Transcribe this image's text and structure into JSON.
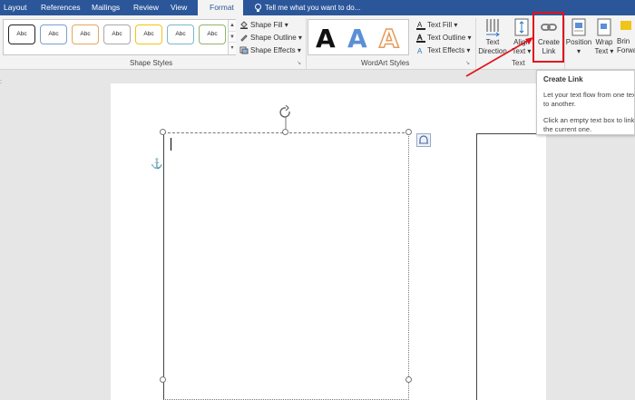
{
  "tabs": [
    {
      "label": "Layout",
      "active": false
    },
    {
      "label": "References",
      "active": false
    },
    {
      "label": "Mailings",
      "active": false
    },
    {
      "label": "Review",
      "active": false
    },
    {
      "label": "View",
      "active": false
    },
    {
      "label": "Format",
      "active": true
    }
  ],
  "tell_me": "Tell me what you want to do...",
  "shape_styles": {
    "label": "Shape Styles",
    "presets": [
      "Abc",
      "Abc",
      "Abc",
      "Abc",
      "Abc",
      "Abc",
      "Abc"
    ],
    "preset_colors": [
      "#222222",
      "#7b9fcf",
      "#e3a85f",
      "#a9a9a9",
      "#f0c419",
      "#78b8c8",
      "#8fb56a"
    ],
    "shape_fill": "Shape Fill",
    "shape_outline": "Shape Outline",
    "shape_effects": "Shape Effects"
  },
  "wordart_styles": {
    "label": "WordArt Styles",
    "letters": [
      "A",
      "A",
      "A"
    ],
    "text_fill": "Text Fill",
    "text_outline": "Text Outline",
    "text_effects": "Text Effects"
  },
  "text_group": {
    "label": "Text",
    "text_direction": [
      "Text",
      "Direction"
    ],
    "align_text": [
      "Align",
      "Text"
    ],
    "create_link": [
      "Create",
      "Link"
    ]
  },
  "arrange": {
    "position": "Position",
    "wrap_text": [
      "Wrap",
      "Text"
    ],
    "bring_forward": [
      "Brin",
      "Forwa"
    ]
  },
  "tooltip": {
    "title": "Create Link",
    "line1": "Let your text flow from one tex",
    "line2": "to another.",
    "line3": "Click an empty text box to link",
    "line4": "the current one."
  },
  "colors": {
    "accent": "#2b579a",
    "highlight": "#e0131b",
    "anchor": "#3b6fb5"
  }
}
